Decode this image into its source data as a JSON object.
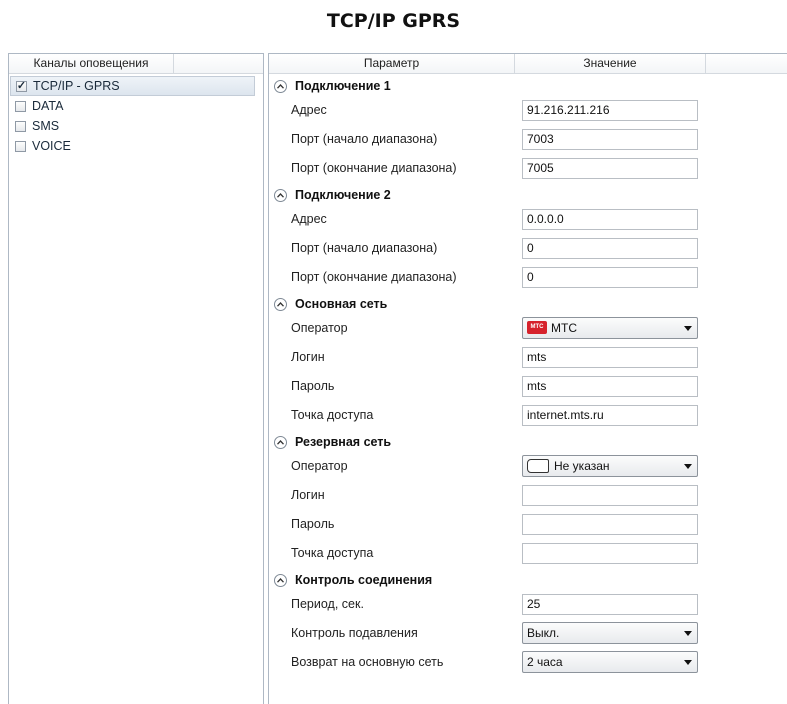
{
  "page": {
    "title": "TCP/IP GPRS"
  },
  "left_panel": {
    "header": "Каналы оповещения",
    "items": [
      {
        "label": "TCP/IP - GPRS",
        "checked": true,
        "selected": true
      },
      {
        "label": "DATA",
        "checked": false,
        "selected": false
      },
      {
        "label": "SMS",
        "checked": false,
        "selected": false
      },
      {
        "label": "VOICE",
        "checked": false,
        "selected": false
      }
    ]
  },
  "right_panel": {
    "headers": {
      "param": "Параметр",
      "value": "Значение"
    },
    "sections": [
      {
        "title": "Подключение 1",
        "rows": [
          {
            "label": "Адрес",
            "value": "91.216.211.216",
            "type": "text"
          },
          {
            "label": "Порт (начало диапазона)",
            "value": "7003",
            "type": "text"
          },
          {
            "label": "Порт (окончание диапазона)",
            "value": "7005",
            "type": "text"
          }
        ]
      },
      {
        "title": "Подключение 2",
        "rows": [
          {
            "label": "Адрес",
            "value": "0.0.0.0",
            "type": "text"
          },
          {
            "label": "Порт (начало диапазона)",
            "value": "0",
            "type": "text"
          },
          {
            "label": "Порт (окончание диапазона)",
            "value": "0",
            "type": "text"
          }
        ]
      },
      {
        "title": "Основная сеть",
        "rows": [
          {
            "label": "Оператор",
            "value": "МТС",
            "type": "combo",
            "icon": "mts-operator-icon",
            "icon_text": "MTC"
          },
          {
            "label": "Логин",
            "value": "mts",
            "type": "text"
          },
          {
            "label": "Пароль",
            "value": "mts",
            "type": "text"
          },
          {
            "label": "Точка доступа",
            "value": "internet.mts.ru",
            "type": "text"
          }
        ]
      },
      {
        "title": "Резервная сеть",
        "rows": [
          {
            "label": "Оператор",
            "value": "Не указан",
            "type": "combo",
            "icon": "no-operator-icon"
          },
          {
            "label": "Логин",
            "value": "",
            "type": "text"
          },
          {
            "label": "Пароль",
            "value": "",
            "type": "text"
          },
          {
            "label": "Точка доступа",
            "value": "",
            "type": "text"
          }
        ]
      },
      {
        "title": "Контроль соединения",
        "rows": [
          {
            "label": "Период, сек.",
            "value": "25",
            "type": "text"
          },
          {
            "label": "Контроль подавления",
            "value": "Выкл.",
            "type": "combo"
          },
          {
            "label": "Возврат на основную сеть",
            "value": "2 часа",
            "type": "combo"
          }
        ]
      }
    ]
  },
  "colors": {
    "mts_brand": "#d6222c",
    "panel_border": "#aeb8c4"
  }
}
